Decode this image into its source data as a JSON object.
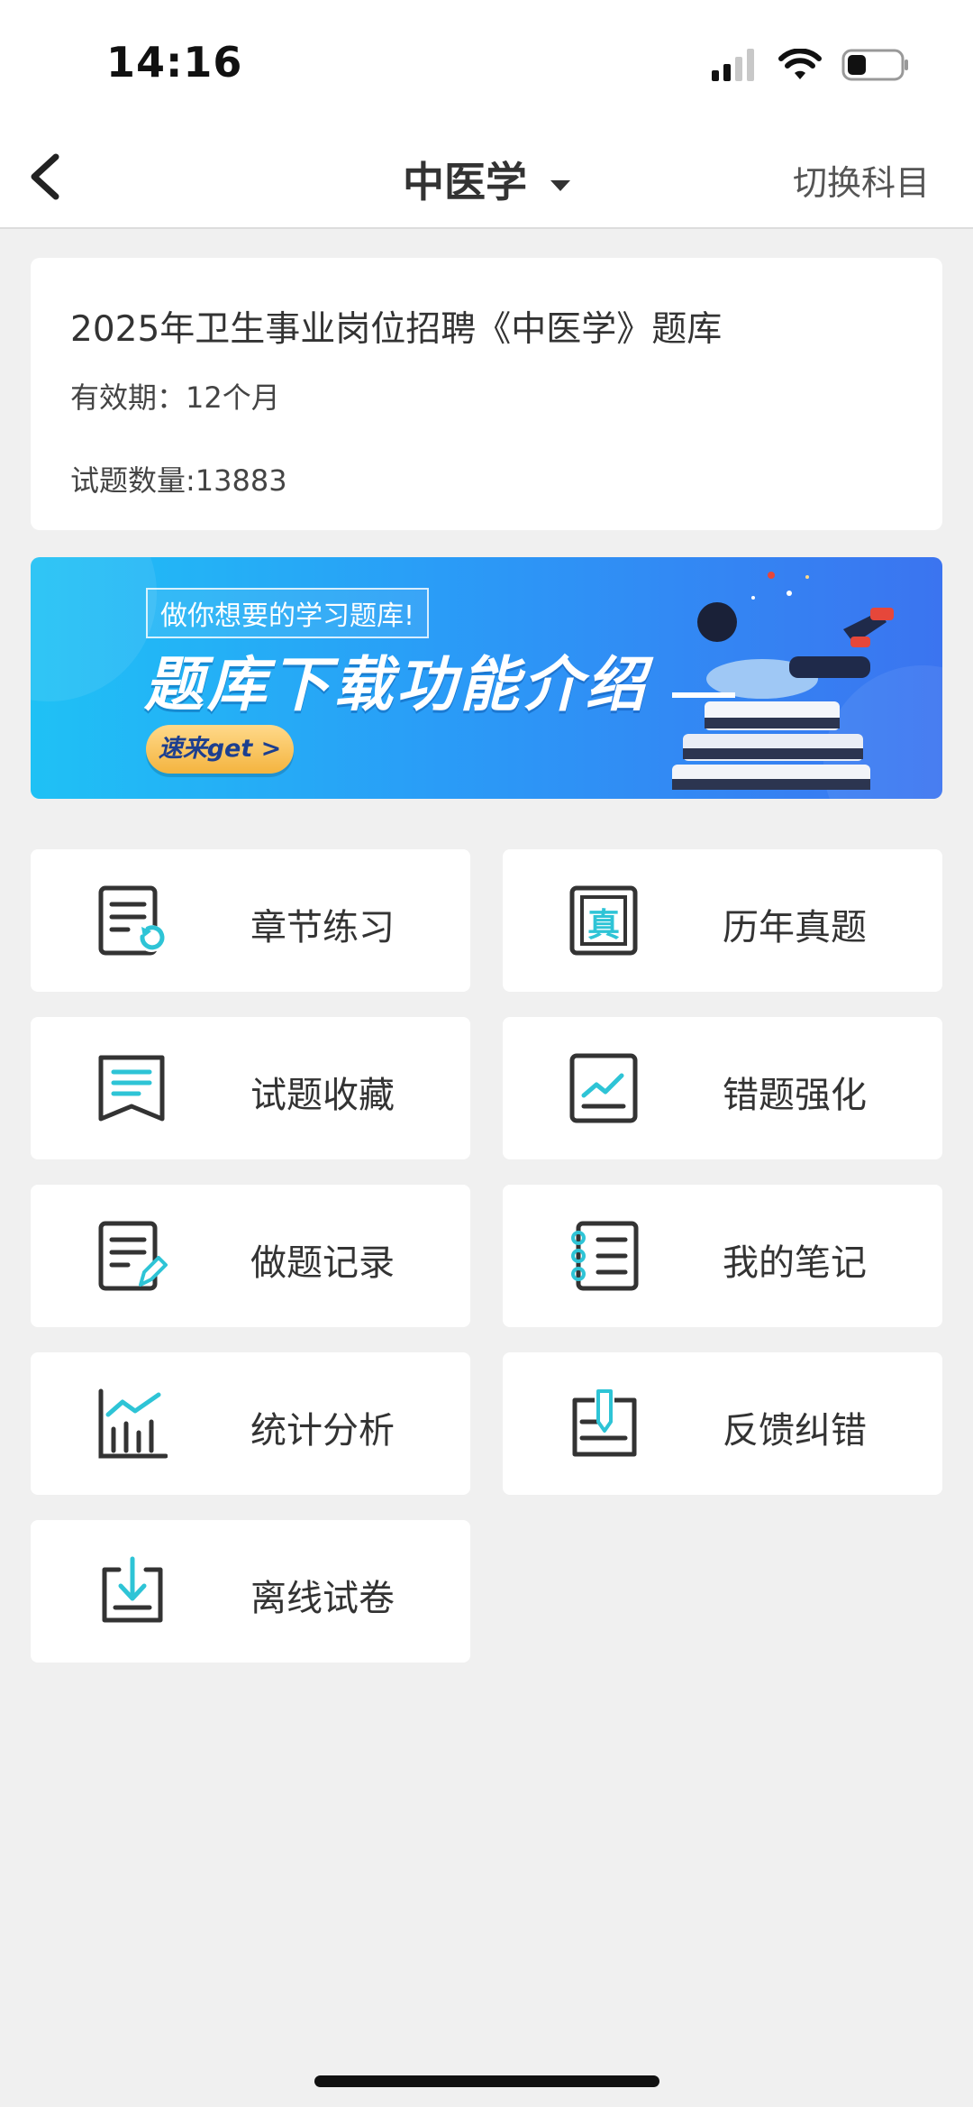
{
  "status_bar": {
    "time": "14:16"
  },
  "nav": {
    "title": "中医学",
    "switch_label": "切换科目"
  },
  "bank": {
    "title": "2025年卫生事业岗位招聘《中医学》题库",
    "validity": "有效期：12个月",
    "question_count": "试题数量:13883"
  },
  "banner": {
    "tag": "做你想要的学习题库!",
    "title": "题库下载功能介绍",
    "button": "速来get >"
  },
  "menu": {
    "items": [
      {
        "label": "章节练习",
        "icon": "chapter-practice-icon"
      },
      {
        "label": "历年真题",
        "icon": "past-exams-icon"
      },
      {
        "label": "试题收藏",
        "icon": "bookmark-icon"
      },
      {
        "label": "错题强化",
        "icon": "mistake-trend-icon"
      },
      {
        "label": "做题记录",
        "icon": "record-edit-icon"
      },
      {
        "label": "我的笔记",
        "icon": "notebook-icon"
      },
      {
        "label": "统计分析",
        "icon": "statistics-chart-icon"
      },
      {
        "label": "反馈纠错",
        "icon": "feedback-icon"
      },
      {
        "label": "离线试卷",
        "icon": "download-tray-icon"
      }
    ]
  },
  "colors": {
    "accent": "#2ec4d6",
    "icon_stroke": "#333333",
    "background": "#f0f0f0"
  }
}
